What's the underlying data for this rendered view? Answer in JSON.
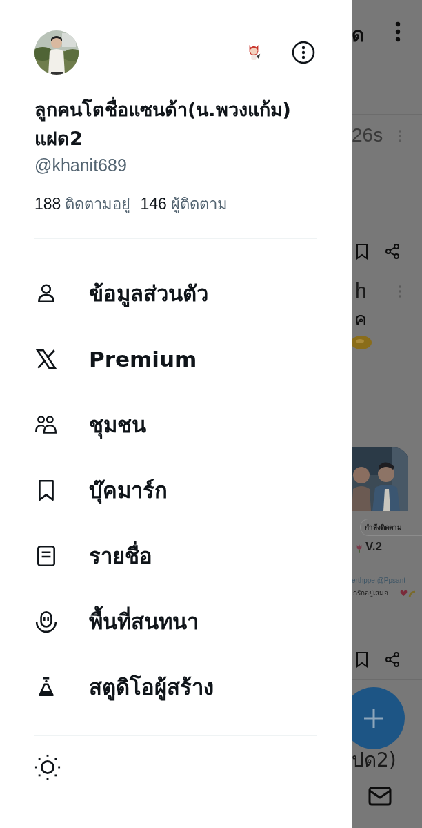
{
  "profile": {
    "name": "ลูกคนโตชื่อแซนต้า(น.พวงแก้ม)แฝด2",
    "handle": "@khanit689",
    "following_count": "188",
    "following_label": "ติดตามอยู่",
    "followers_count": "146",
    "followers_label": "ผู้ติดตาม"
  },
  "menu": [
    {
      "kind": "profile",
      "label": "ข้อมูลส่วนตัว"
    },
    {
      "kind": "premium",
      "label": "Premium"
    },
    {
      "kind": "communities",
      "label": "ชุมชน"
    },
    {
      "kind": "bookmarks",
      "label": "บุ๊คมาร์ก"
    },
    {
      "kind": "lists",
      "label": "รายชื่อ"
    },
    {
      "kind": "spaces",
      "label": "พื้นที่สนทนา"
    },
    {
      "kind": "studio",
      "label": "สตูดิโอผู้สร้าง"
    }
  ],
  "backdrop": {
    "title_fragment": "ด",
    "time_fragment": "26s",
    "post_fragment_1": "h",
    "post_fragment_2": "ค",
    "follow_chip": "กำลังติดตาม",
    "card_title": "V.2",
    "card_author": "erthppe @Ppsant",
    "card_text": "กรักอยู่เสมอ",
    "bottom_fragment": "ปด2)"
  }
}
